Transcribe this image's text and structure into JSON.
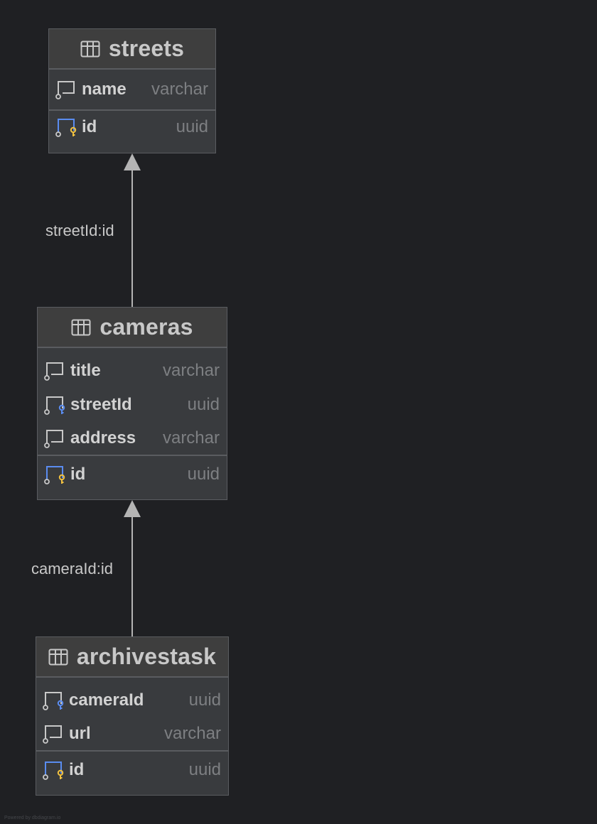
{
  "tables": {
    "streets": {
      "name": "streets",
      "columns": [
        {
          "name": "name",
          "type": "varchar",
          "kind": "plain"
        }
      ],
      "pk": {
        "name": "id",
        "type": "uuid"
      }
    },
    "cameras": {
      "name": "cameras",
      "columns": [
        {
          "name": "title",
          "type": "varchar",
          "kind": "plain"
        },
        {
          "name": "streetId",
          "type": "uuid",
          "kind": "fk"
        },
        {
          "name": "address",
          "type": "varchar",
          "kind": "plain"
        }
      ],
      "pk": {
        "name": "id",
        "type": "uuid"
      }
    },
    "archivestask": {
      "name": "archivestask",
      "columns": [
        {
          "name": "cameraId",
          "type": "uuid",
          "kind": "fk"
        },
        {
          "name": "url",
          "type": "varchar",
          "kind": "plain"
        }
      ],
      "pk": {
        "name": "id",
        "type": "uuid"
      }
    }
  },
  "relations": [
    {
      "label": "streetId:id",
      "from": "cameras",
      "to": "streets"
    },
    {
      "label": "cameraId:id",
      "from": "archivestask",
      "to": "cameras"
    }
  ],
  "colors": {
    "background": "#1f2023",
    "table_body": "#393b3e",
    "table_header": "#3e3e3e",
    "border": "#5a5c60",
    "pk_key": "#f0c040",
    "fk_key": "#5a8cf0",
    "connector": "#b4b4b4"
  },
  "footer": "Powered by dbdiagram.io"
}
